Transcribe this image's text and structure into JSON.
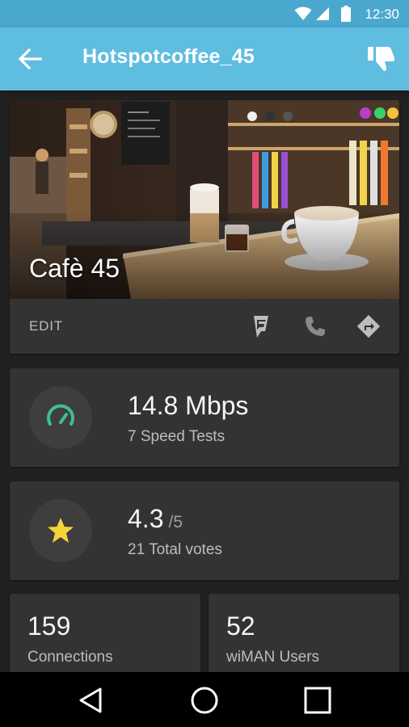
{
  "status_bar": {
    "time": "12:30",
    "icons": [
      "wifi-icon",
      "cell-signal-icon",
      "battery-icon"
    ]
  },
  "app_bar": {
    "title": "Hotspotcoffee_45",
    "back_icon": "arrow-left-icon",
    "dislike_icon": "thumbs-down-icon",
    "color": "#5fbde0"
  },
  "place": {
    "name": "Cafè 45",
    "edit_label": "EDIT",
    "actions": [
      "foursquare-icon",
      "phone-icon",
      "directions-icon"
    ]
  },
  "speed": {
    "value": "14.8 Mbps",
    "subtitle": "7 Speed Tests",
    "icon": "speedometer-icon",
    "icon_color": "#3fbf8f"
  },
  "rating": {
    "value": "4.3",
    "scale": "/5",
    "subtitle": "21 Total votes",
    "icon": "star-icon",
    "icon_color": "#f5d33a"
  },
  "connections": {
    "value": "159",
    "label": "Connections"
  },
  "wiman_users": {
    "value": "52",
    "label": "wiMAN Users"
  },
  "nav_bar": {
    "buttons": [
      "back-triangle-icon",
      "home-circle-icon",
      "recents-square-icon"
    ]
  }
}
